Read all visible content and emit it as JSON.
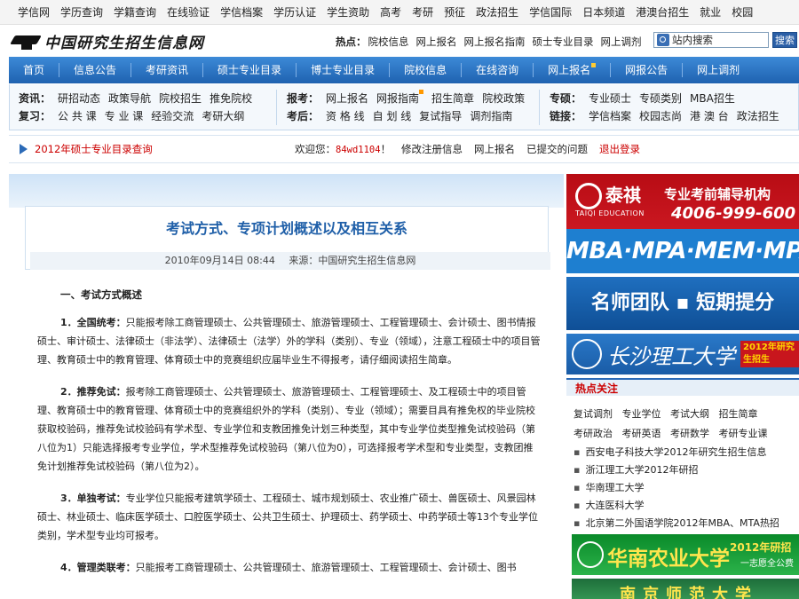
{
  "topnav": [
    "学信网",
    "学历查询",
    "学籍查询",
    "在线验证",
    "学信档案",
    "学历认证",
    "学生资助",
    "高考",
    "考研",
    "预征",
    "政法招生",
    "学信国际",
    "日本频道",
    "港澳台招生",
    "就业",
    "校园"
  ],
  "site": {
    "logo_text": "中国研究生招生信息网"
  },
  "hot": {
    "label": "热点：",
    "items": [
      "院校信息",
      "网上报名",
      "网上报名指南",
      "硕士专业目录",
      "网上调剂"
    ]
  },
  "search": {
    "label": "站内搜索",
    "button": "搜索"
  },
  "mainnav": [
    "首页",
    "信息公告",
    "考研资讯",
    "硕士专业目录",
    "博士专业目录",
    "院校信息",
    "在线咨询",
    "网上报名",
    "网报公告",
    "网上调剂"
  ],
  "subnav": {
    "col1": {
      "row1_label": "资讯：",
      "row1": [
        "研招动态",
        "政策导航",
        "院校招生",
        "推免院校"
      ],
      "row2_label": "复习：",
      "row2": [
        "公 共 课",
        "专 业 课",
        "经验交流",
        "考研大纲"
      ]
    },
    "col2": {
      "row1_label": "报考：",
      "row1": [
        "网上报名",
        "网报指南",
        "招生简章",
        "院校政策"
      ],
      "row2_label": "考后：",
      "row2": [
        "资 格 线",
        "自 划 线",
        "复试指导",
        "调剂指南"
      ]
    },
    "col3": {
      "row1_label": "专硕：",
      "row1": [
        "专业硕士",
        "专硕类别",
        "MBA招生"
      ],
      "row2_label": "链接：",
      "row2": [
        "学信档案",
        "校园志尚",
        "港 澳 台",
        "政法招生"
      ]
    }
  },
  "userbar": {
    "catalog_link": "2012年硕士专业目录查询",
    "welcome": "欢迎您：",
    "username": "84wd1104",
    "suffix": "！",
    "links": [
      "修改注册信息",
      "网上报名",
      "已提交的问题"
    ],
    "logout": "退出登录"
  },
  "article": {
    "title": "考试方式、专项计划概述以及相互关系",
    "date": "2010年09月14日 08:44",
    "source": "来源：中国研究生招生信息网",
    "section1": "一、考试方式概述",
    "paragraphs": [
      {
        "lead": "1．全国统考：",
        "text": "只能报考除工商管理硕士、公共管理硕士、旅游管理硕士、工程管理硕士、会计硕士、图书情报硕士、审计硕士、法律硕士（非法学）、法律硕士（法学）外的学科（类别）、专业（领域），注意工程硕士中的项目管理、教育硕士中的教育管理、体育硕士中的竞赛组织应届毕业生不得报考，请仔细阅读招生简章。"
      },
      {
        "lead": "2．推荐免试：",
        "text": "报考除工商管理硕士、公共管理硕士、旅游管理硕士、工程管理硕士、及工程硕士中的项目管理、教育硕士中的教育管理、体育硕士中的竞赛组织外的学科（类别）、专业（领域）；需要目具有推免权的毕业院校获取校验码，推荐免试校验码有学术型、专业学位和支教团推免计划三种类型，其中专业学位类型推免试校验码（第八位为1）只能选择报考专业学位，学术型推荐免试校验码（第八位为0），可选择报考学术型和专业类型，支教团推免计划推荐免试校验码（第八位为2）。"
      },
      {
        "lead": "3．单独考试：",
        "text": "专业学位只能报考建筑学硕士、工程硕士、城市规划硕士、农业推广硕士、兽医硕士、风景园林硕士、林业硕士、临床医学硕士、口腔医学硕士、公共卫生硕士、护理硕士、药学硕士、中药学硕士等13个专业学位类别，学术型专业均可报考。"
      },
      {
        "lead": "4．管理类联考：",
        "text": "只能报考工商管理硕士、公共管理硕士、旅游管理硕士、工程管理硕士、会计硕士、图书"
      }
    ]
  },
  "ads": {
    "taiqi_brand": "泰祺",
    "taiqi_en": "TAIQI EDUCATION",
    "taiqi_tag": "专业考前辅导机构",
    "taiqi_phone": "4006-999-600",
    "taiqi_programs": "MBA·MPA·MEM·MPAcc",
    "mingshi": "名师团队 ▪ 短期提分",
    "csust_name": "长沙理工大学",
    "csust_tag": "2012年研究生招生",
    "scau_name": "华南农业大学",
    "scau_tag": "2012年研招",
    "scau_tag2": "一志愿全公费",
    "njnu_name": "南京师范大学"
  },
  "hotfocus": {
    "label": "热点关注",
    "row1": [
      "复试调剂",
      "专业学位",
      "考试大纲",
      "招生简章"
    ],
    "row2": [
      "考研政治",
      "考研英语",
      "考研数学",
      "考研专业课"
    ],
    "list": [
      "西安电子科技大学2012年研究生招生信息",
      "浙江理工大学2012年研招",
      "华南理工大学",
      "大连医科大学",
      "北京第二外国语学院2012年MBA、MTA热招"
    ]
  }
}
